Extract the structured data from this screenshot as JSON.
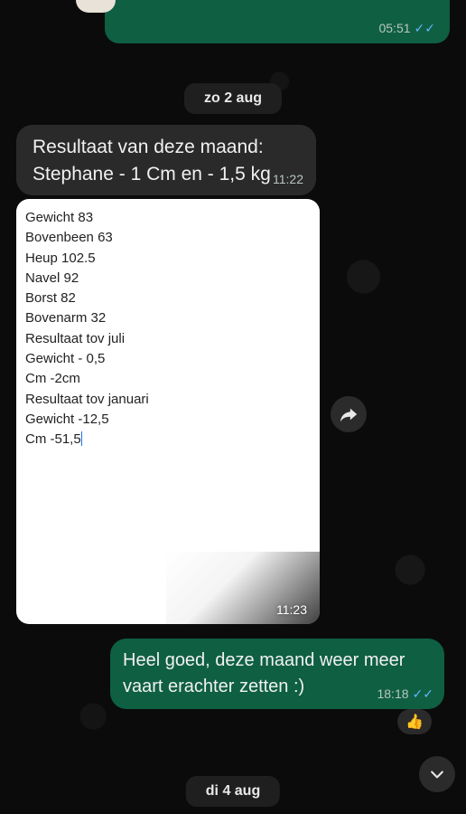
{
  "colors": {
    "outgoing_bubble": "#0f5f43",
    "incoming_bubble": "#2a2a2a",
    "read_ticks": "#63b6ff",
    "background": "#0b0b0b"
  },
  "top_message": {
    "time": "05:51",
    "status_icon": "double-check-icon"
  },
  "date_separators": [
    "zo 2 aug",
    "di 4 aug"
  ],
  "incoming_text": {
    "text": "Resultaat van deze maand: Stephane - 1 Cm en - 1,5 kg",
    "time": "11:22"
  },
  "incoming_image": {
    "lines": [
      "Gewicht 83",
      "Bovenbeen 63",
      "Heup 102.5",
      "Navel 92",
      "Borst 82",
      "Bovenarm 32",
      "Resultaat tov juli",
      "Gewicht - 0,5",
      "Cm -2cm",
      "Resultaat tov januari",
      "Gewicht  -12,5",
      "Cm -51,5"
    ],
    "time": "11:23"
  },
  "outgoing_reply": {
    "text": "Heel goed, deze maand weer meer vaart erachter zetten :)",
    "time": "18:18",
    "status_icon": "double-check-icon"
  },
  "reaction_emoji": "👍",
  "icons": {
    "forward": "forward-icon",
    "scroll_down": "chevron-down-icon"
  }
}
